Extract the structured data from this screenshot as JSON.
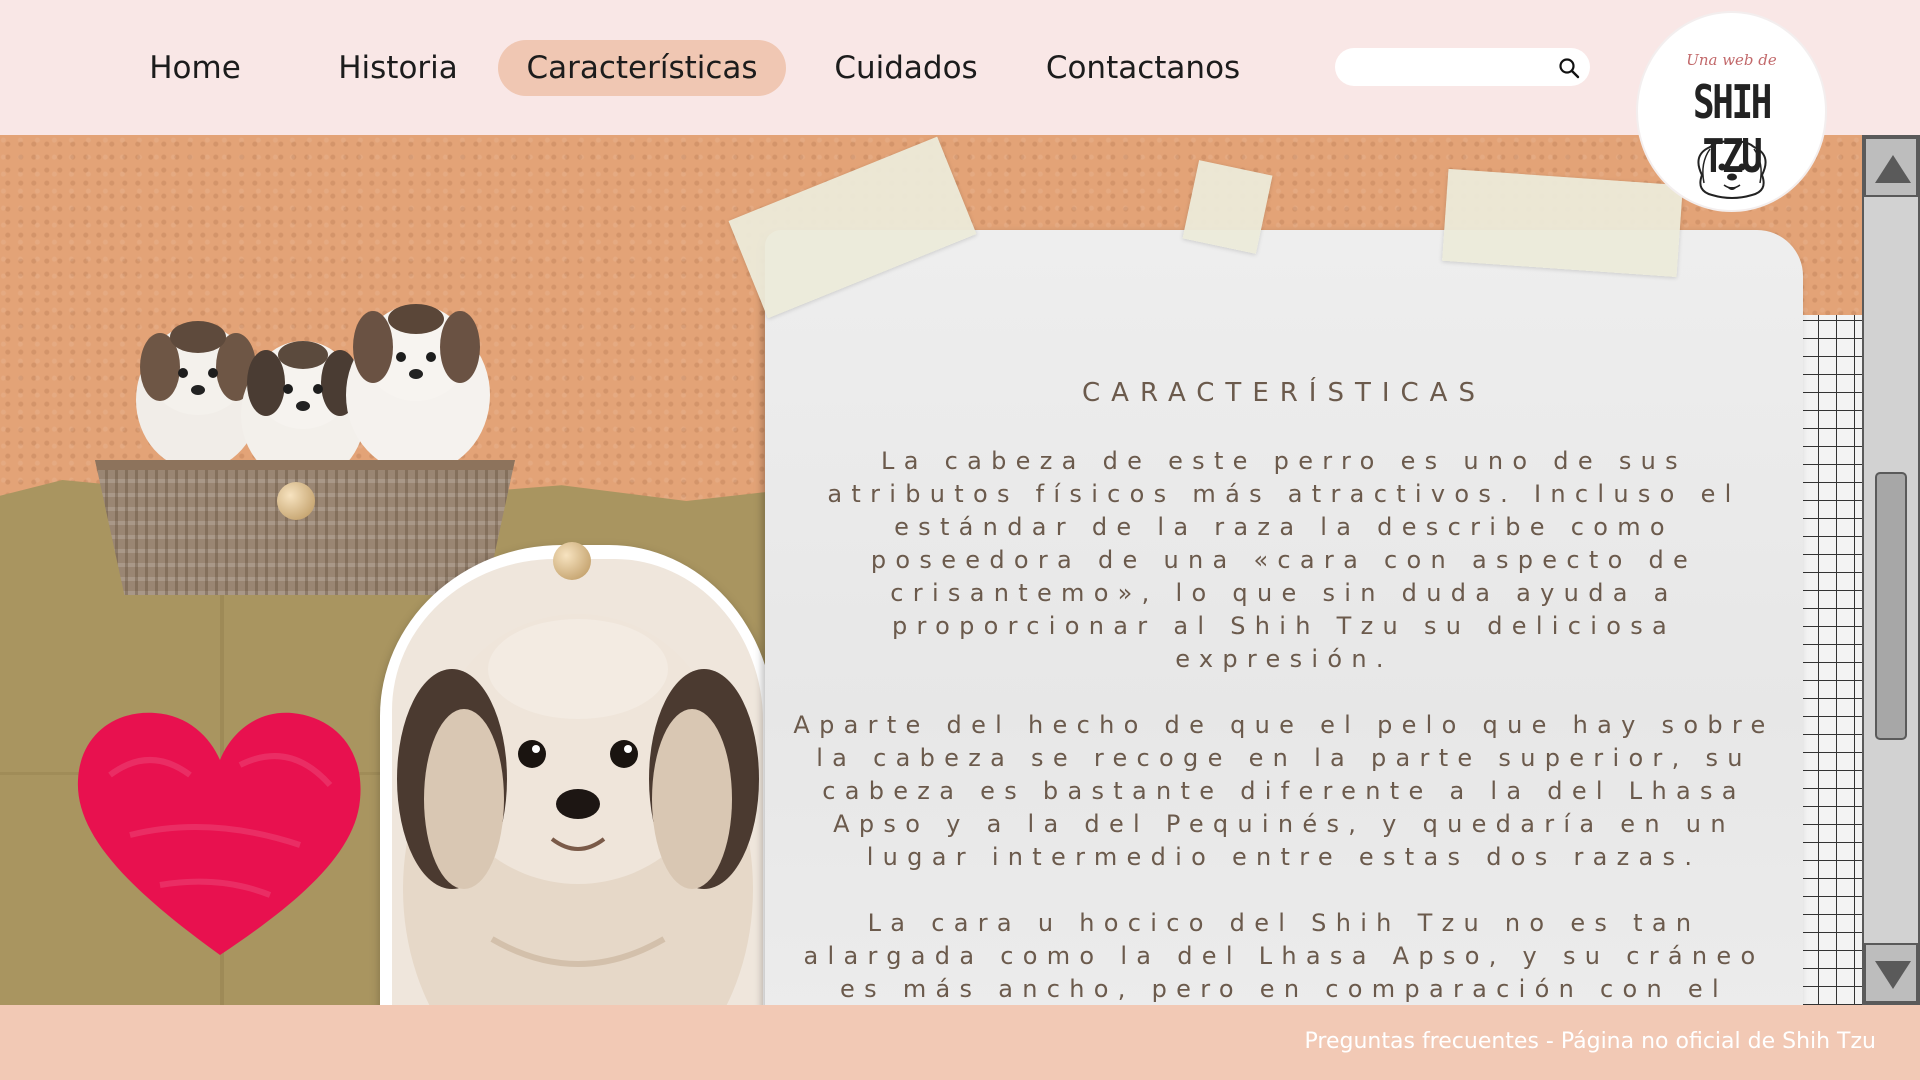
{
  "nav": {
    "items": [
      {
        "label": "Home"
      },
      {
        "label": "Historia"
      },
      {
        "label": "Características"
      },
      {
        "label": "Cuidados"
      },
      {
        "label": "Contactanos"
      }
    ],
    "active": "Características"
  },
  "search": {
    "placeholder": "",
    "icon": "search-icon"
  },
  "logo": {
    "small_text": "Una web de",
    "main_text": "SHIH TZU"
  },
  "content": {
    "title": "CARACTERÍSTICAS",
    "paragraphs": [
      "La cabeza de este perro es uno de sus atributos físicos más atractivos. Incluso el estándar de la raza la describe como poseedora de una «cara con aspecto de crisantemo», lo que sin duda ayuda a proporcionar al Shih Tzu su deliciosa expresión.",
      "Aparte del hecho de que el pelo que hay sobre la cabeza se recoge en la parte superior, su cabeza es bastante diferente a la del Lhasa Apso y a la del Pequinés, y quedaría en un lugar intermedio entre estas dos razas.",
      "La cara u hocico del Shih Tzu no es tan alargada como la del Lhasa Apso, y su cráneo es más ancho, pero en comparación con el Pequinés, el hocico del Shih Tzu es más alargado y el cráneo"
    ]
  },
  "scrollbar": {
    "position": 0.45
  },
  "footer": {
    "link": "Preguntas frecuentes - Página no oficial de Shih Tzu"
  },
  "colors": {
    "header_bg": "#f9e7e6",
    "nav_active": "#f0c7b3",
    "cork": "#e3a377",
    "paper_text": "#6b5a4c",
    "footer_bg": "#f2c9b5",
    "heart": "#e8114f"
  }
}
